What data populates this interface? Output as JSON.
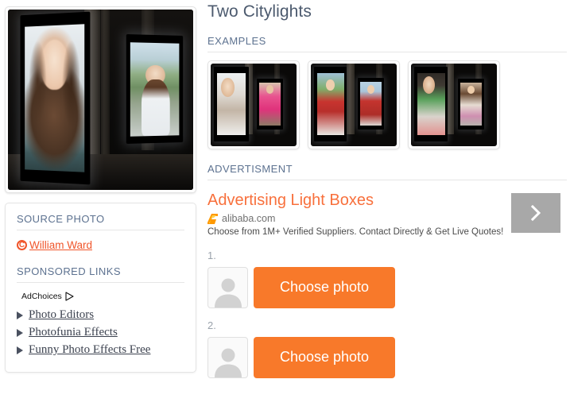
{
  "page": {
    "title": "Two Citylights"
  },
  "sections": {
    "examples_label": "EXAMPLES",
    "advertisement_label": "ADVERTISMENT",
    "source_photo_label": "SOURCE PHOTO",
    "sponsored_links_label": "SPONSORED LINKS"
  },
  "preview": {
    "alt": "Two illuminated citylight billboards at night showing portraits of two women"
  },
  "examples": [
    {
      "alt": "Example 1 - two citylight billboards with a woman in white and a woman in a pink dress"
    },
    {
      "alt": "Example 2 - two citylight billboards with a man in a red polo shirt"
    },
    {
      "alt": "Example 3 - two citylight billboards with a woman in a striped top"
    }
  ],
  "source_photo": {
    "license_icon": "creative-commons-icon",
    "author": "William Ward"
  },
  "sponsored": {
    "adchoices_label": "AdChoices",
    "adchoices_icon": "adchoices-triangle-icon",
    "links": [
      {
        "label": "Photo Editors"
      },
      {
        "label": "Photofunia Effects"
      },
      {
        "label": "Funny Photo Effects Free"
      }
    ]
  },
  "advertisement": {
    "headline": "Advertising Light Boxes",
    "domain": "alibaba.com",
    "favicon": "alibaba-favicon",
    "description": "Choose from 1M+ Verified Suppliers. Contact Directly & Get Live Quotes!",
    "arrow_icon": "chevron-right-icon"
  },
  "steps": [
    {
      "number": "1.",
      "avatar_icon": "person-placeholder-icon",
      "button_label": "Choose photo"
    },
    {
      "number": "2.",
      "avatar_icon": "person-placeholder-icon",
      "button_label": "Choose photo"
    }
  ],
  "colors": {
    "accent_orange": "#f8792a",
    "ad_headline_orange": "#f8703c",
    "link_orange": "#f0552a",
    "heading_slate": "#5d7290",
    "title_slate": "#4c5a6e"
  }
}
